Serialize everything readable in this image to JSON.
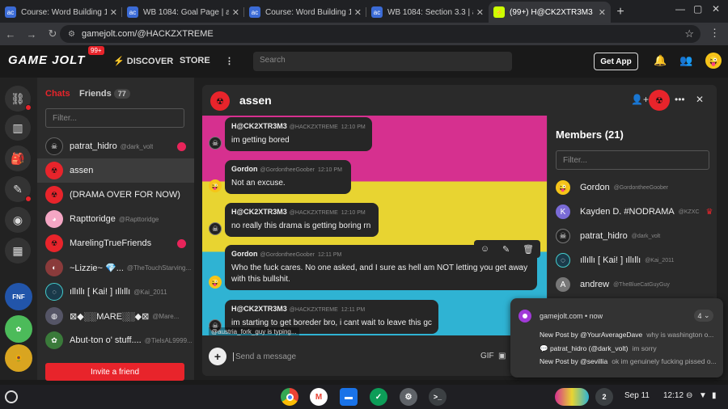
{
  "browser": {
    "tabs": [
      {
        "label": "Course: Word Building 1084"
      },
      {
        "label": "WB 1084: Goal Page | acecon"
      },
      {
        "label": "Course: Word Building 1084"
      },
      {
        "label": "WB 1084: Section 3.3 | aceco"
      },
      {
        "label": "(99+) H@CK2XTR3M3 (@HA"
      }
    ],
    "new_tab": "+",
    "url": "gamejolt.com/@HACKZXTREME"
  },
  "topbar": {
    "logo": "GAME JOLT",
    "badge": "99+",
    "discover": "DISCOVER",
    "store": "STORE",
    "search_placeholder": "Search",
    "get_app": "Get App"
  },
  "sidebar": {
    "tab_chats": "Chats",
    "tab_friends": "Friends",
    "friends_count": "77",
    "filter_placeholder": "Filter...",
    "chats": [
      {
        "name": "patrat_hidro",
        "handle": "@dark_volt",
        "unread": true,
        "color": "#222"
      },
      {
        "name": "assen",
        "handle": "",
        "unread": false,
        "color": "#e8242b"
      },
      {
        "name": "(DRAMA OVER FOR NOW)",
        "handle": "",
        "unread": false,
        "color": "#e8242b"
      },
      {
        "name": "Rapttoridge",
        "handle": "@Rapttoridge",
        "unread": false,
        "color": "#f4a6c4"
      },
      {
        "name": "MarelingTrueFriends",
        "handle": "",
        "unread": true,
        "color": "#e8242b"
      },
      {
        "name": "~Lizzie~ 💎...",
        "handle": "@TheTouchStarving...",
        "unread": false,
        "color": "#8a3b3b"
      },
      {
        "name": "ıllıllı [ Kai! ] ıllıllı",
        "handle": "@Kai_2011",
        "unread": false,
        "color": "#1a3a4a"
      },
      {
        "name": "⊠◆░░MARE░░◆⊠",
        "handle": "@Mare...",
        "unread": false,
        "color": "#556"
      },
      {
        "name": "Abut-ton o' stuff....",
        "handle": "@TielsAL9999...",
        "unread": false,
        "color": "#3a7a3a"
      }
    ],
    "invite_label": "Invite a friend"
  },
  "chat": {
    "title": "assen",
    "messages": [
      {
        "author": "H@CK2XTR3M3",
        "handle": "@HACKZXTREME",
        "time": "12:10 PM",
        "text": "im getting bored"
      },
      {
        "author": "Gordon",
        "handle": "@GordontheeGoober",
        "time": "12:10 PM",
        "text": "Not an excuse."
      },
      {
        "author": "H@CK2XTR3M3",
        "handle": "@HACKZXTREME",
        "time": "12:10 PM",
        "text": "no really this drama is getting boring rn"
      },
      {
        "author": "Gordon",
        "handle": "@GordontheeGoober",
        "time": "12:11 PM",
        "text": "Who the fuck cares. No one asked, and I sure as hell am NOT letting you get away with this bullshit."
      },
      {
        "author": "H@CK2XTR3M3",
        "handle": "@HACKZXTREME",
        "time": "12:11 PM",
        "text": "im starting to get boreder bro, i cant wait to leave this gc"
      }
    ],
    "typing": "@austria_fork_guy is typing...",
    "composer_placeholder": "Send a message"
  },
  "members": {
    "title": "Members (21)",
    "filter_placeholder": "Filter...",
    "list": [
      {
        "name": "Gordon",
        "handle": "@GordontheeGoober",
        "color": "#f5c518",
        "glyph": "😜"
      },
      {
        "name": "Kayden D. #NODRAMA",
        "handle": "@KZXC",
        "color": "#7a6bd6",
        "glyph": "K"
      },
      {
        "name": "patrat_hidro",
        "handle": "@dark_volt",
        "color": "#222",
        "glyph": "☠"
      },
      {
        "name": "ıllıllı [ Kai! ] ıllıllı",
        "handle": "@Kai_2011",
        "color": "#1a3a4a",
        "glyph": "K"
      },
      {
        "name": "andrew",
        "handle": "@TheBlueCatGuyGuy",
        "color": "#777",
        "glyph": "A"
      }
    ]
  },
  "notification": {
    "source": "gamejolt.com • now",
    "count": "4",
    "lines": [
      {
        "title": "New Post by @YourAverageDave",
        "body": "why is washington o..."
      },
      {
        "title": "💬 patrat_hidro (@dark_volt)",
        "body": "im sorry"
      },
      {
        "title": "New Post by @sevillia",
        "body": "ok im genuinely fucking pissed o..."
      }
    ]
  },
  "shelf": {
    "badge": "2",
    "date": "Sep 11",
    "time": "12:12"
  }
}
